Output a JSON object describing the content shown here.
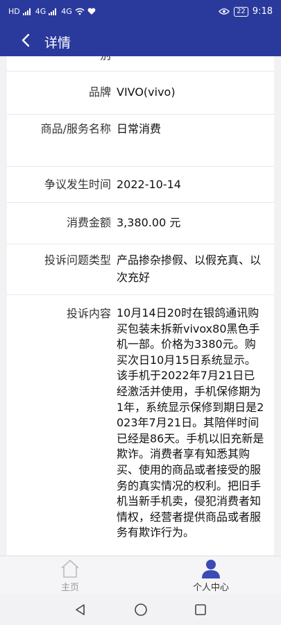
{
  "status_bar": {
    "left_labels": [
      "HD",
      "4G",
      "4G"
    ],
    "battery": "22",
    "time": "9:18"
  },
  "header": {
    "title": "详情",
    "back_icon": "chevron-left-icon"
  },
  "details": {
    "partial_label": "别",
    "rows": [
      {
        "label": "品牌",
        "value": "VIVO(vivo)"
      },
      {
        "label": "商品/服务名称",
        "value": "日常消费"
      },
      {
        "label": "争议发生时间",
        "value": "2022-10-14"
      },
      {
        "label": "消费金额",
        "value": "3,380.00 元"
      },
      {
        "label": "投诉问题类型",
        "value": "产品掺杂掺假、以假充真、以次充好"
      },
      {
        "label": "投诉内容",
        "value": "10月14日20时在银鸽通讯购买包装未拆新vivox80黑色手机一部。价格为3380元。购买次日10月15日系统显示。该手机于2022年7月21日已经激活并使用，手机保修期为1年，系统显示保修到期日是2023年7月21日。其陪伴时间已经是86天。手机以旧充新是欺诈。消费者享有知悉其购买、使用的商品或者接受的服务的真实情况的权利。把旧手机当新手机卖，侵犯消费者知情权，经营者提供商品或者服务有欺诈行为。"
      }
    ]
  },
  "tab_bar": {
    "tabs": [
      {
        "label": "主页",
        "icon": "home-icon",
        "active": false
      },
      {
        "label": "个人中心",
        "icon": "person-icon",
        "active": true
      }
    ]
  },
  "colors": {
    "header_bg": "#2a3a9c",
    "active_tab": "#3b4bb5",
    "inactive_tab": "#999999"
  }
}
